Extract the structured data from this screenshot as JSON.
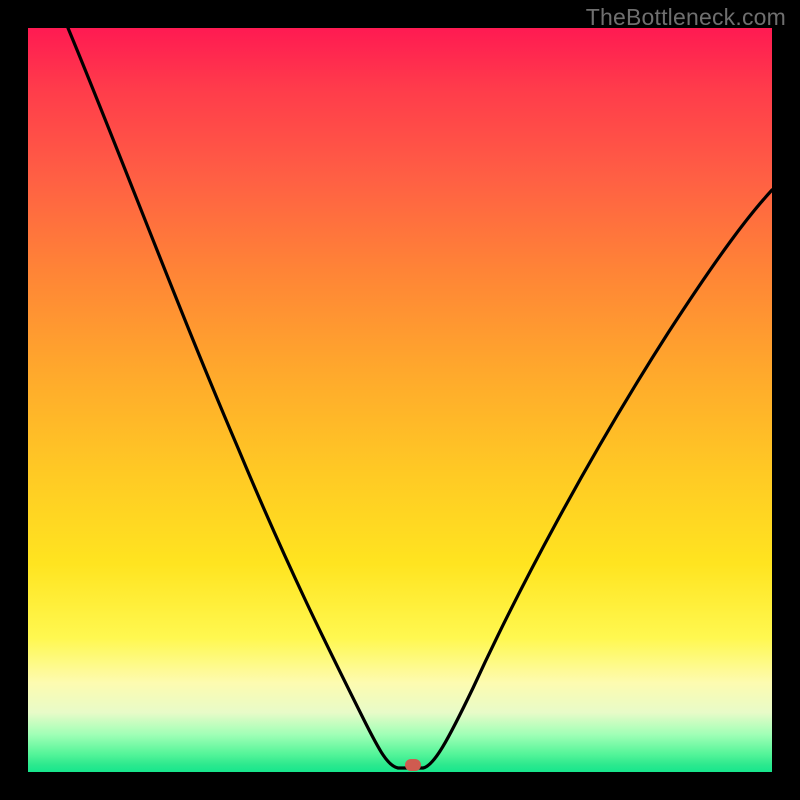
{
  "watermark": "TheBottleneck.com",
  "chart_data": {
    "type": "line",
    "title": "",
    "xlabel": "",
    "ylabel": "",
    "xlim": [
      0,
      100
    ],
    "ylim": [
      0,
      100
    ],
    "grid": false,
    "annotations": [],
    "series": [
      {
        "name": "bottleneck-curve",
        "x": [
          0,
          5,
          10,
          15,
          20,
          25,
          30,
          35,
          40,
          43,
          46,
          48,
          49,
          50,
          52,
          55,
          58,
          62,
          66,
          70,
          75,
          80,
          85,
          90,
          95,
          100
        ],
        "y": [
          100,
          90,
          80,
          70,
          60,
          51,
          42,
          33,
          23,
          15,
          8,
          3,
          1,
          1,
          1,
          3,
          8,
          15,
          23,
          31,
          41,
          50,
          58,
          65,
          71,
          77
        ]
      }
    ],
    "marker": {
      "x": 50,
      "y": 0,
      "color": "#cf5b50"
    },
    "background_gradient": {
      "top": "#ff1a52",
      "mid": "#ffca24",
      "bottom": "#16e68d"
    }
  }
}
